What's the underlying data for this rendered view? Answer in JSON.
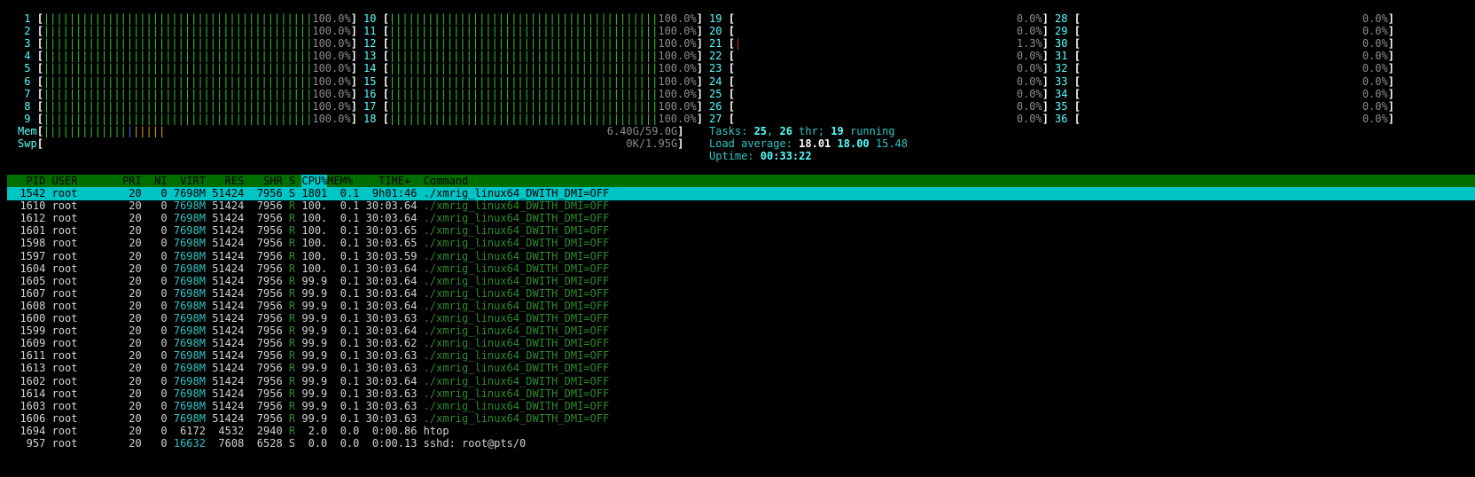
{
  "cpu_columns": [
    [
      {
        "id": "1",
        "pct": "100.0%",
        "level": 1.0
      },
      {
        "id": "2",
        "pct": "100.0%",
        "level": 1.0
      },
      {
        "id": "3",
        "pct": "100.0%",
        "level": 1.0
      },
      {
        "id": "4",
        "pct": "100.0%",
        "level": 1.0
      },
      {
        "id": "5",
        "pct": "100.0%",
        "level": 1.0
      },
      {
        "id": "6",
        "pct": "100.0%",
        "level": 1.0
      },
      {
        "id": "7",
        "pct": "100.0%",
        "level": 1.0
      },
      {
        "id": "8",
        "pct": "100.0%",
        "level": 1.0
      },
      {
        "id": "9",
        "pct": "100.0%",
        "level": 1.0
      }
    ],
    [
      {
        "id": "10",
        "pct": "100.0%",
        "level": 1.0
      },
      {
        "id": "11",
        "pct": "100.0%",
        "level": 1.0
      },
      {
        "id": "12",
        "pct": "100.0%",
        "level": 1.0
      },
      {
        "id": "13",
        "pct": "100.0%",
        "level": 1.0
      },
      {
        "id": "14",
        "pct": "100.0%",
        "level": 1.0
      },
      {
        "id": "15",
        "pct": "100.0%",
        "level": 1.0
      },
      {
        "id": "16",
        "pct": "100.0%",
        "level": 1.0
      },
      {
        "id": "17",
        "pct": "100.0%",
        "level": 1.0
      },
      {
        "id": "18",
        "pct": "100.0%",
        "level": 1.0
      }
    ],
    [
      {
        "id": "19",
        "pct": "0.0%",
        "level": 0
      },
      {
        "id": "20",
        "pct": "0.0%",
        "level": 0
      },
      {
        "id": "21",
        "pct": "1.3%",
        "level": 0.013
      },
      {
        "id": "22",
        "pct": "0.0%",
        "level": 0
      },
      {
        "id": "23",
        "pct": "0.0%",
        "level": 0
      },
      {
        "id": "24",
        "pct": "0.0%",
        "level": 0
      },
      {
        "id": "25",
        "pct": "0.0%",
        "level": 0
      },
      {
        "id": "26",
        "pct": "0.0%",
        "level": 0
      },
      {
        "id": "27",
        "pct": "0.0%",
        "level": 0
      }
    ],
    [
      {
        "id": "28",
        "pct": "0.0%",
        "level": 0
      },
      {
        "id": "29",
        "pct": "0.0%",
        "level": 0
      },
      {
        "id": "30",
        "pct": "0.0%",
        "level": 0
      },
      {
        "id": "31",
        "pct": "0.0%",
        "level": 0
      },
      {
        "id": "32",
        "pct": "0.0%",
        "level": 0
      },
      {
        "id": "33",
        "pct": "0.0%",
        "level": 0
      },
      {
        "id": "34",
        "pct": "0.0%",
        "level": 0
      },
      {
        "id": "35",
        "pct": "0.0%",
        "level": 0
      },
      {
        "id": "36",
        "pct": "0.0%",
        "level": 0
      }
    ]
  ],
  "mem": {
    "label": "Mem",
    "value": "6.40G/59.0G"
  },
  "swp": {
    "label": "Swp",
    "value": "0K/1.95G"
  },
  "tasks": {
    "label": "Tasks: ",
    "count": "25",
    "sep": ", ",
    "thr": "26",
    "thr_label": " thr; ",
    "running": "19",
    "running_label": " running"
  },
  "load": {
    "label": "Load average: ",
    "v1": "18.01",
    "v2": "18.00",
    "v3": "15.48"
  },
  "uptime": {
    "label": "Uptime: ",
    "value": "00:33:22"
  },
  "columns": {
    "pid": "PID",
    "user": "USER",
    "pri": "PRI",
    "ni": "NI",
    "virt": "VIRT",
    "res": "RES",
    "shr": "SHR",
    "s": "S",
    "cpu": "CPU%",
    "mem": "MEM%",
    "time": "TIME+",
    "command": "Command"
  },
  "processes": [
    {
      "pid": "1542",
      "user": "root",
      "pri": "20",
      "ni": "0",
      "virt": "7698M",
      "res": "51424",
      "shr": "7956",
      "s": "S",
      "cpu": "1801",
      "mem": "0.1",
      "time": "9h01:46",
      "cmd": "./xmrig_linux64_DWITH_DMI=OFF"
    },
    {
      "pid": "1610",
      "user": "root",
      "pri": "20",
      "ni": "0",
      "virt": "7698M",
      "res": "51424",
      "shr": "7956",
      "s": "R",
      "cpu": "100.",
      "mem": "0.1",
      "time": "30:03.64",
      "cmd": "./xmrig_linux64_DWITH_DMI=OFF"
    },
    {
      "pid": "1612",
      "user": "root",
      "pri": "20",
      "ni": "0",
      "virt": "7698M",
      "res": "51424",
      "shr": "7956",
      "s": "R",
      "cpu": "100.",
      "mem": "0.1",
      "time": "30:03.64",
      "cmd": "./xmrig_linux64_DWITH_DMI=OFF"
    },
    {
      "pid": "1601",
      "user": "root",
      "pri": "20",
      "ni": "0",
      "virt": "7698M",
      "res": "51424",
      "shr": "7956",
      "s": "R",
      "cpu": "100.",
      "mem": "0.1",
      "time": "30:03.65",
      "cmd": "./xmrig_linux64_DWITH_DMI=OFF"
    },
    {
      "pid": "1598",
      "user": "root",
      "pri": "20",
      "ni": "0",
      "virt": "7698M",
      "res": "51424",
      "shr": "7956",
      "s": "R",
      "cpu": "100.",
      "mem": "0.1",
      "time": "30:03.65",
      "cmd": "./xmrig_linux64_DWITH_DMI=OFF"
    },
    {
      "pid": "1597",
      "user": "root",
      "pri": "20",
      "ni": "0",
      "virt": "7698M",
      "res": "51424",
      "shr": "7956",
      "s": "R",
      "cpu": "100.",
      "mem": "0.1",
      "time": "30:03.59",
      "cmd": "./xmrig_linux64_DWITH_DMI=OFF"
    },
    {
      "pid": "1604",
      "user": "root",
      "pri": "20",
      "ni": "0",
      "virt": "7698M",
      "res": "51424",
      "shr": "7956",
      "s": "R",
      "cpu": "100.",
      "mem": "0.1",
      "time": "30:03.64",
      "cmd": "./xmrig_linux64_DWITH_DMI=OFF"
    },
    {
      "pid": "1605",
      "user": "root",
      "pri": "20",
      "ni": "0",
      "virt": "7698M",
      "res": "51424",
      "shr": "7956",
      "s": "R",
      "cpu": "99.9",
      "mem": "0.1",
      "time": "30:03.64",
      "cmd": "./xmrig_linux64_DWITH_DMI=OFF"
    },
    {
      "pid": "1607",
      "user": "root",
      "pri": "20",
      "ni": "0",
      "virt": "7698M",
      "res": "51424",
      "shr": "7956",
      "s": "R",
      "cpu": "99.9",
      "mem": "0.1",
      "time": "30:03.64",
      "cmd": "./xmrig_linux64_DWITH_DMI=OFF"
    },
    {
      "pid": "1608",
      "user": "root",
      "pri": "20",
      "ni": "0",
      "virt": "7698M",
      "res": "51424",
      "shr": "7956",
      "s": "R",
      "cpu": "99.9",
      "mem": "0.1",
      "time": "30:03.64",
      "cmd": "./xmrig_linux64_DWITH_DMI=OFF"
    },
    {
      "pid": "1600",
      "user": "root",
      "pri": "20",
      "ni": "0",
      "virt": "7698M",
      "res": "51424",
      "shr": "7956",
      "s": "R",
      "cpu": "99.9",
      "mem": "0.1",
      "time": "30:03.63",
      "cmd": "./xmrig_linux64_DWITH_DMI=OFF"
    },
    {
      "pid": "1599",
      "user": "root",
      "pri": "20",
      "ni": "0",
      "virt": "7698M",
      "res": "51424",
      "shr": "7956",
      "s": "R",
      "cpu": "99.9",
      "mem": "0.1",
      "time": "30:03.64",
      "cmd": "./xmrig_linux64_DWITH_DMI=OFF"
    },
    {
      "pid": "1609",
      "user": "root",
      "pri": "20",
      "ni": "0",
      "virt": "7698M",
      "res": "51424",
      "shr": "7956",
      "s": "R",
      "cpu": "99.9",
      "mem": "0.1",
      "time": "30:03.62",
      "cmd": "./xmrig_linux64_DWITH_DMI=OFF"
    },
    {
      "pid": "1611",
      "user": "root",
      "pri": "20",
      "ni": "0",
      "virt": "7698M",
      "res": "51424",
      "shr": "7956",
      "s": "R",
      "cpu": "99.9",
      "mem": "0.1",
      "time": "30:03.63",
      "cmd": "./xmrig_linux64_DWITH_DMI=OFF"
    },
    {
      "pid": "1613",
      "user": "root",
      "pri": "20",
      "ni": "0",
      "virt": "7698M",
      "res": "51424",
      "shr": "7956",
      "s": "R",
      "cpu": "99.9",
      "mem": "0.1",
      "time": "30:03.63",
      "cmd": "./xmrig_linux64_DWITH_DMI=OFF"
    },
    {
      "pid": "1602",
      "user": "root",
      "pri": "20",
      "ni": "0",
      "virt": "7698M",
      "res": "51424",
      "shr": "7956",
      "s": "R",
      "cpu": "99.9",
      "mem": "0.1",
      "time": "30:03.64",
      "cmd": "./xmrig_linux64_DWITH_DMI=OFF"
    },
    {
      "pid": "1614",
      "user": "root",
      "pri": "20",
      "ni": "0",
      "virt": "7698M",
      "res": "51424",
      "shr": "7956",
      "s": "R",
      "cpu": "99.9",
      "mem": "0.1",
      "time": "30:03.63",
      "cmd": "./xmrig_linux64_DWITH_DMI=OFF"
    },
    {
      "pid": "1603",
      "user": "root",
      "pri": "20",
      "ni": "0",
      "virt": "7698M",
      "res": "51424",
      "shr": "7956",
      "s": "R",
      "cpu": "99.9",
      "mem": "0.1",
      "time": "30:03.63",
      "cmd": "./xmrig_linux64_DWITH_DMI=OFF"
    },
    {
      "pid": "1606",
      "user": "root",
      "pri": "20",
      "ni": "0",
      "virt": "7698M",
      "res": "51424",
      "shr": "7956",
      "s": "R",
      "cpu": "99.9",
      "mem": "0.1",
      "time": "30:03.63",
      "cmd": "./xmrig_linux64_DWITH_DMI=OFF"
    },
    {
      "pid": "1694",
      "user": "root",
      "pri": "20",
      "ni": "0",
      "virt": "6172",
      "res": "4532",
      "shr": "2940",
      "s": "R",
      "cpu": "2.0",
      "mem": "0.0",
      "time": "0:00.86",
      "cmd": "htop"
    },
    {
      "pid": "957",
      "user": "root",
      "pri": "20",
      "ni": "0",
      "virt": "16632",
      "res": "7608",
      "shr": "6528",
      "s": "S",
      "cpu": "0.0",
      "mem": "0.0",
      "time": "0:00.13",
      "cmd": "sshd: root@pts/0"
    }
  ],
  "colors": {
    "bg": "#000000",
    "header_bar": "#006f00",
    "selected_row": "#00c5c5",
    "cpu_label": "#55ffff",
    "bar_green": "#2ec52e"
  }
}
